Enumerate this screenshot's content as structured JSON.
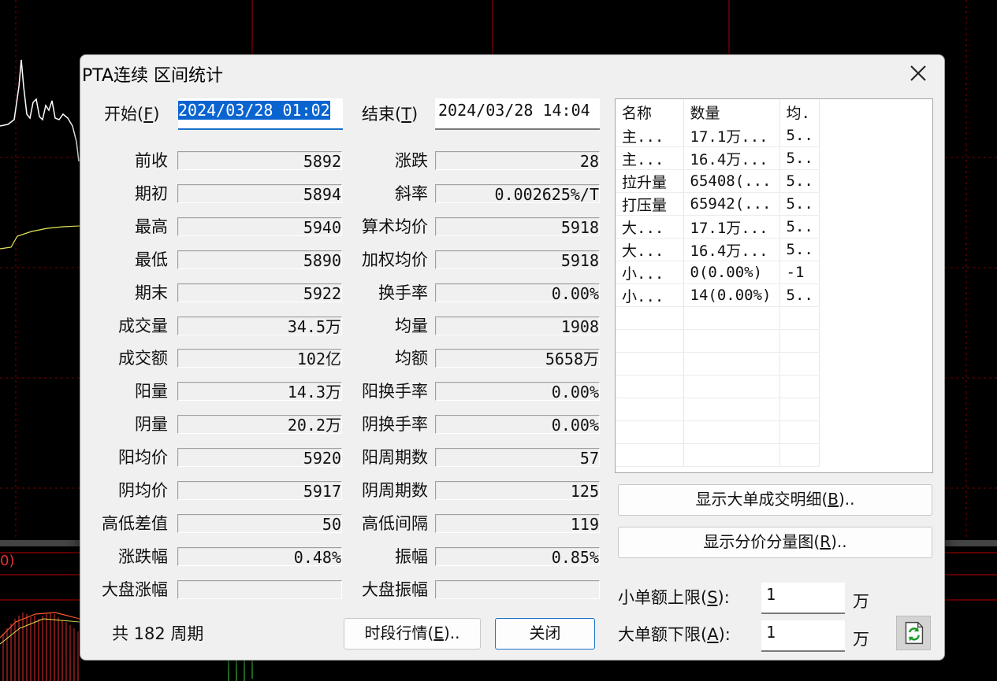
{
  "dialog": {
    "title": "PTA连续 区间统计",
    "start_label": "开始(",
    "start_key": "F",
    "start_value": "2024/03/28 01:02",
    "end_label": "结束(",
    "end_key": "T",
    "end_value": "2024/03/28 14:04",
    "label_close_paren": ")"
  },
  "left_stats": [
    {
      "label": "前收",
      "value": "5892"
    },
    {
      "label": "期初",
      "value": "5894"
    },
    {
      "label": "最高",
      "value": "5940"
    },
    {
      "label": "最低",
      "value": "5890"
    },
    {
      "label": "期末",
      "value": "5922"
    },
    {
      "label": "成交量",
      "value": "34.5万"
    },
    {
      "label": "成交额",
      "value": "102亿"
    },
    {
      "label": "阳量",
      "value": "14.3万"
    },
    {
      "label": "阴量",
      "value": "20.2万"
    },
    {
      "label": "阳均价",
      "value": "5920"
    },
    {
      "label": "阴均价",
      "value": "5917"
    },
    {
      "label": "高低差值",
      "value": "50"
    },
    {
      "label": "涨跌幅",
      "value": "0.48%"
    },
    {
      "label": "大盘涨幅",
      "value": ""
    }
  ],
  "right_stats": [
    {
      "label": "涨跌",
      "value": "28"
    },
    {
      "label": "斜率",
      "value": "0.002625%/T"
    },
    {
      "label": "算术均价",
      "value": "5918"
    },
    {
      "label": "加权均价",
      "value": "5918"
    },
    {
      "label": "换手率",
      "value": "0.00%"
    },
    {
      "label": "均量",
      "value": "1908"
    },
    {
      "label": "均额",
      "value": "5658万"
    },
    {
      "label": "阳换手率",
      "value": "0.00%"
    },
    {
      "label": "阴换手率",
      "value": "0.00%"
    },
    {
      "label": "阳周期数",
      "value": "57"
    },
    {
      "label": "阴周期数",
      "value": "125"
    },
    {
      "label": "高低间隔",
      "value": "119"
    },
    {
      "label": "振幅",
      "value": "0.85%"
    },
    {
      "label": "大盘振幅",
      "value": ""
    }
  ],
  "footer": {
    "period_text": "共 182 周期",
    "period_btn_label": "时段行情(",
    "period_btn_key": "E",
    "period_btn_suffix": ")..",
    "close_label": "关闭"
  },
  "table": {
    "columns": [
      "名称",
      "数量",
      "均."
    ],
    "rows": [
      [
        "主...",
        "17.1万...",
        "5.."
      ],
      [
        "主...",
        "16.4万...",
        "5.."
      ],
      [
        "拉升量",
        "65408(...",
        "5.."
      ],
      [
        "打压量",
        "65942(...",
        "5.."
      ],
      [
        "大...",
        "17.1万...",
        "5.."
      ],
      [
        "大...",
        "16.4万...",
        "5.."
      ],
      [
        "小...",
        "0(0.00%)",
        "-1"
      ],
      [
        "小...",
        "14(0.00%)",
        "5.."
      ]
    ]
  },
  "buttons": {
    "big_order_prefix": "显示大单成交明细(",
    "big_order_key": "B",
    "big_order_suffix": ")..",
    "price_chart_prefix": "显示分价分量图(",
    "price_chart_key": "R",
    "price_chart_suffix": ")..",
    "refresh_icon": "refresh-icon"
  },
  "thresholds": {
    "small_label_prefix": "小单额上限(",
    "small_key": "S",
    "small_label_suffix": "):",
    "small_value": "1",
    "large_label_prefix": "大单额下限(",
    "large_key": "A",
    "large_label_suffix": "):",
    "large_value": "1",
    "unit": "万"
  },
  "background": {
    "fragment_text": "0)"
  },
  "colors": {
    "selection": "#0a64d0",
    "focus_border": "#1a73c8",
    "grid_red": "#8b0000",
    "price_line": "#ffffff",
    "avg_line": "#e8e85a"
  }
}
